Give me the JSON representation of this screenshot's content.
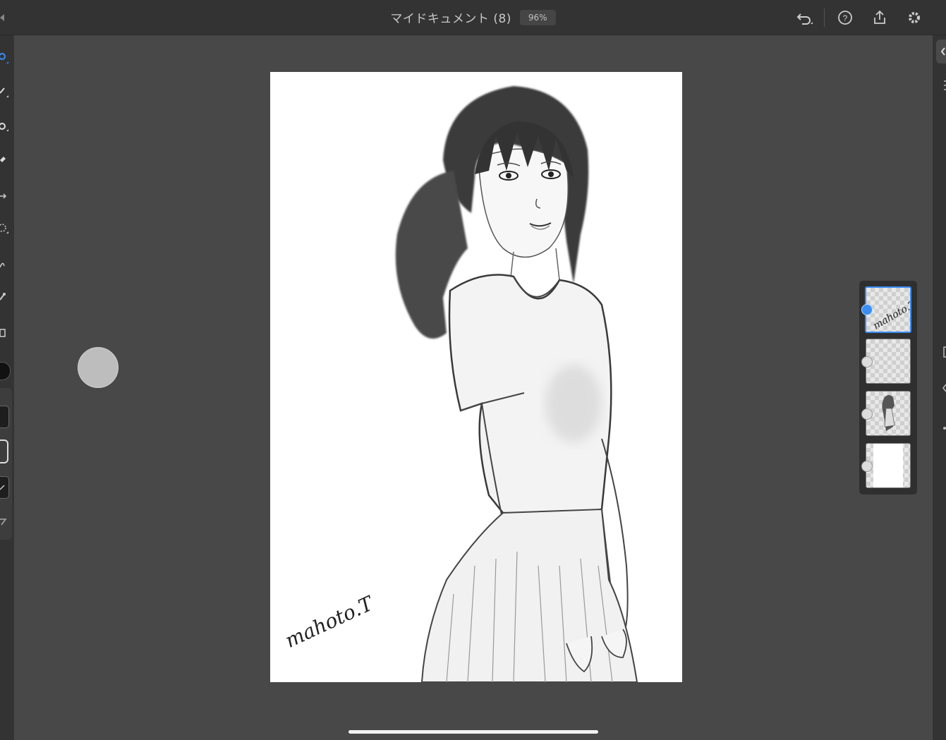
{
  "header": {
    "title": "マイドキュメント (8)",
    "zoom": "96%",
    "icons": [
      "undo-icon",
      "help-icon",
      "share-icon",
      "settings-icon"
    ]
  },
  "left_toolbar": {
    "tools": [
      "select-icon",
      "brush-icon",
      "fill-icon",
      "eraser-icon",
      "transform-icon",
      "lasso-icon",
      "smudge-icon",
      "eyedropper-icon",
      "image-icon",
      "color-swatch-icon",
      "brush-size-icon",
      "opacity-icon",
      "flow-icon",
      "settings-slider-icon"
    ]
  },
  "canvas": {
    "signature": "mahoto.T"
  },
  "layers": [
    {
      "label": "signature layer",
      "selected": true
    },
    {
      "label": "empty layer",
      "selected": false
    },
    {
      "label": "sketch layer",
      "selected": false
    },
    {
      "label": "background layer",
      "selected": false
    }
  ],
  "colors": {
    "accent": "#3a8df5",
    "chrome": "#333333",
    "workspace": "#484848"
  }
}
